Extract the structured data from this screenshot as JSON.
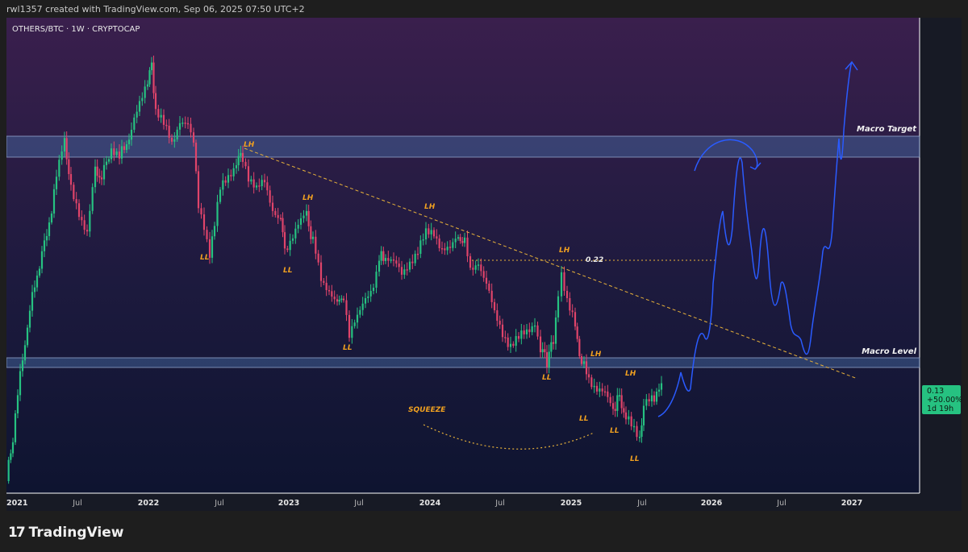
{
  "header": {
    "attribution": "rwl1357 created with TradingView.com, Sep 06, 2025 07:50 UTC+2"
  },
  "chart_data": {
    "type": "candlestick",
    "title": "OTHERS/BTC · 1W · CRYPTOCAP",
    "x_tick_labels": [
      "2021",
      "Jul",
      "2022",
      "Jul",
      "2023",
      "Jul",
      "2024",
      "Jul",
      "2025",
      "Jul",
      "2026",
      "Jul",
      "2027"
    ],
    "x_range": [
      "2021-01",
      "2027-03"
    ],
    "scale": "log",
    "grid": false,
    "zones": [
      {
        "label": "Macro Target",
        "color": "#4a6fa8"
      },
      {
        "label": "Macro Level",
        "color": "#4a6fa8"
      }
    ],
    "annotations": [
      {
        "text": "LH",
        "date": "2022-08"
      },
      {
        "text": "LL",
        "date": "2022-06"
      },
      {
        "text": "LH",
        "date": "2023-03"
      },
      {
        "text": "LL",
        "date": "2023-02"
      },
      {
        "text": "LL",
        "date": "2023-10"
      },
      {
        "text": "LH",
        "date": "2024-03"
      },
      {
        "text": "LL",
        "date": "2024-12"
      },
      {
        "text": "LH",
        "date": "2024-12"
      },
      {
        "text": "LH",
        "date": "2025-01"
      },
      {
        "text": "LL",
        "date": "2025-01"
      },
      {
        "text": "LL",
        "date": "2025-04"
      },
      {
        "text": "LH",
        "date": "2025-05"
      },
      {
        "text": "LL",
        "date": "2025-06"
      },
      {
        "text": "SQUEEZE",
        "date": "2023-10"
      },
      {
        "text": "0.22",
        "date": "2025-02"
      }
    ],
    "last_price": {
      "value": "0.13",
      "change": "+50.00%",
      "countdown": "1d 19h"
    },
    "colors": {
      "up": "#26c281",
      "down": "#e0446a",
      "projection": "#2a5bff",
      "trendline": "#e8b23a",
      "label": "#f0a020",
      "zone": "#4a6fa8",
      "background_top": "#3a1f4d",
      "background_bottom": "#0e1430"
    }
  },
  "footer": {
    "brand": "TradingView",
    "logo_mark": "17"
  }
}
